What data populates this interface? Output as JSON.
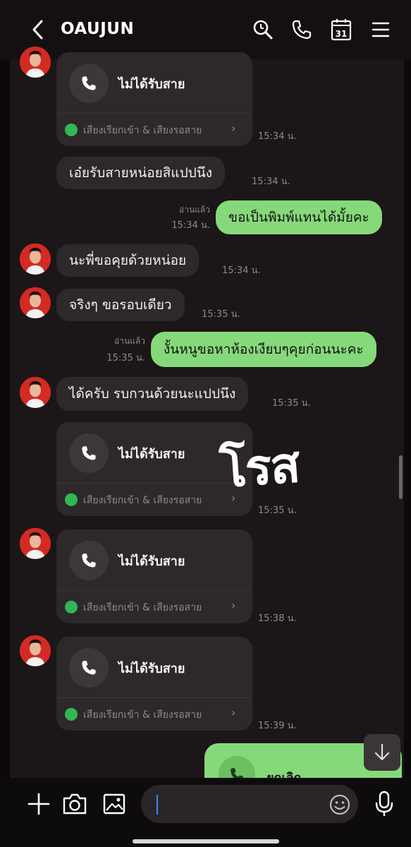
{
  "header": {
    "title": "OAUJUN",
    "back_icon": "chevron-left-icon",
    "actions": [
      "search-icon",
      "phone-icon",
      "calendar-icon",
      "menu-icon"
    ],
    "calendar_day": "31"
  },
  "messages": {
    "call1": {
      "title": "ไม่ได้รับสาย",
      "footer": "เสียงเรียกเข้า & เสียงรอสาย",
      "time": "15:34 น."
    },
    "m1": {
      "text": "เอ๋ยรับสายหน่อยสิแปปนึง",
      "time": "15:34 น."
    },
    "m2": {
      "text": "ขอเป็นพิมพ์แทนได้มั้ยคะ",
      "read": "อ่านแล้ว",
      "time": "15:34 น."
    },
    "m3": {
      "text": "นะพี่ขอคุยด้วยหน่อย",
      "time": "15:34 น."
    },
    "m4": {
      "text": "จริงๆ ขอรอบเดียว",
      "time": "15:35 น."
    },
    "m5": {
      "text": "งั้นหนูขอหาห้องเงียบๆคุยก่อนนะคะ",
      "read": "อ่านแล้ว",
      "time": "15:35 น."
    },
    "m6": {
      "text": "ได้ครับ รบกวนด้วยนะแปปนึง",
      "time": "15:35 น."
    },
    "call2": {
      "title": "ไม่ได้รับสาย",
      "footer": "เสียงเรียกเข้า & เสียงรอสาย",
      "time": "15:35 น."
    },
    "call3": {
      "title": "ไม่ได้รับสาย",
      "footer": "เสียงเรียกเข้า & เสียงรอสาย",
      "time": "15:38 น."
    },
    "call4": {
      "title": "ไม่ได้รับสาย",
      "footer": "เสียงเรียกเข้า & เสียงรอสาย",
      "time": "15:39 น."
    },
    "out_call": {
      "title": "ยกเลิก"
    }
  },
  "watermark": "โรส",
  "composer": {
    "icons": [
      "plus-icon",
      "camera-icon",
      "image-icon",
      "emoji-icon",
      "mic-icon"
    ],
    "input_value": ""
  },
  "colors": {
    "outgoing_bubble": "#86d97a",
    "incoming_bubble": "#2d2829",
    "background": "#1b1617",
    "line_green": "#2fb855"
  }
}
